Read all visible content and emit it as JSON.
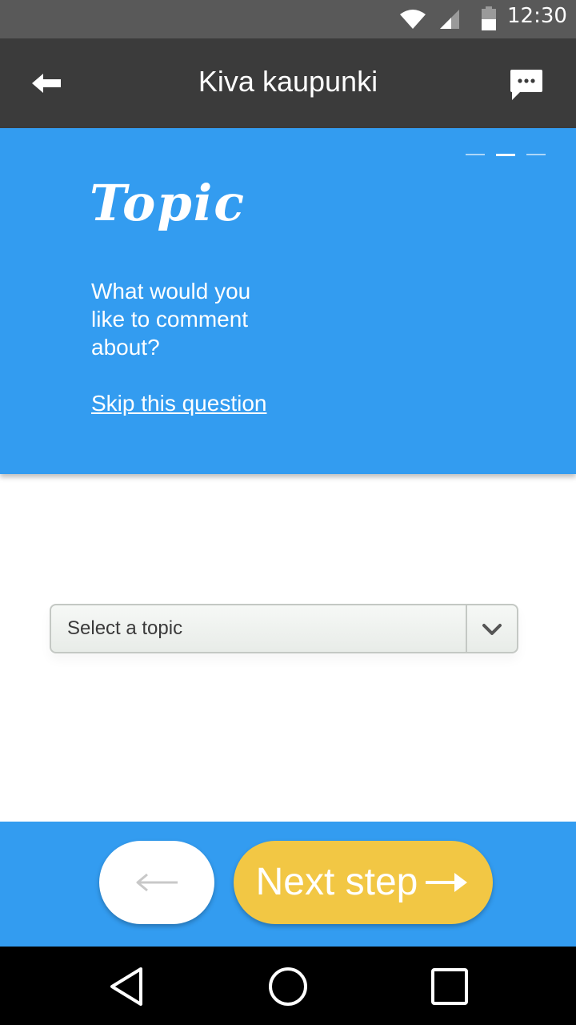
{
  "status_bar": {
    "time": "12:30",
    "icons": [
      "wifi-icon",
      "signal-icon",
      "battery-icon"
    ]
  },
  "app_bar": {
    "title": "Kiva kaupunki",
    "back_icon": "arrow-left-icon",
    "chat_icon": "chat-bubble-icon"
  },
  "question": {
    "title": "Topic",
    "prompt": "What would you like to comment about?",
    "skip_label": "Skip this question",
    "steps_total": 3,
    "current_step": 2,
    "background_color": "#339cf0"
  },
  "topic_select": {
    "placeholder": "Select a topic",
    "icon": "chevron-down-icon"
  },
  "navigation": {
    "next_label": "Next step",
    "next_icon": "arrow-right-icon",
    "prev_icon": "arrow-left-icon",
    "next_color": "#f2c744"
  },
  "system_nav": {
    "icons": [
      "back-triangle-icon",
      "home-circle-icon",
      "recents-square-icon"
    ]
  }
}
